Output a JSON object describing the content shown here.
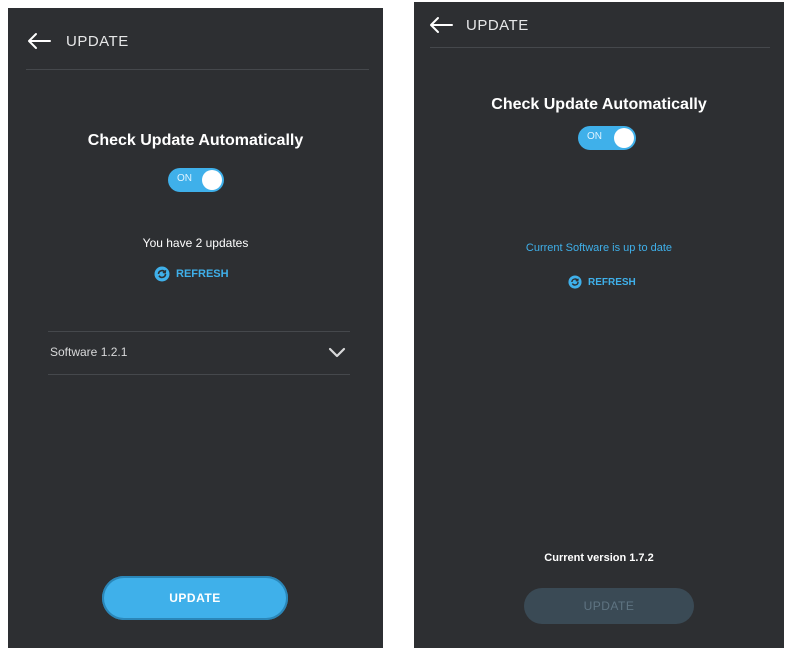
{
  "screens": [
    {
      "header": {
        "title": "UPDATE"
      },
      "auto_update": {
        "label": "Check Update Automatically",
        "toggle_state": "ON"
      },
      "status_text": "You have 2 updates",
      "refresh_label": "REFRESH",
      "software_item": "Software 1.2.1",
      "update_button": "UPDATE"
    },
    {
      "header": {
        "title": "UPDATE"
      },
      "auto_update": {
        "label": "Check Update Automatically",
        "toggle_state": "ON"
      },
      "status_text": "Current Software is up to date",
      "refresh_label": "REFRESH",
      "current_version": "Current version 1.7.2",
      "update_button": "UPDATE"
    }
  ],
  "colors": {
    "panel_bg": "#2d2f32",
    "accent": "#3fb0ea",
    "disabled_button": "#3a4a55"
  }
}
